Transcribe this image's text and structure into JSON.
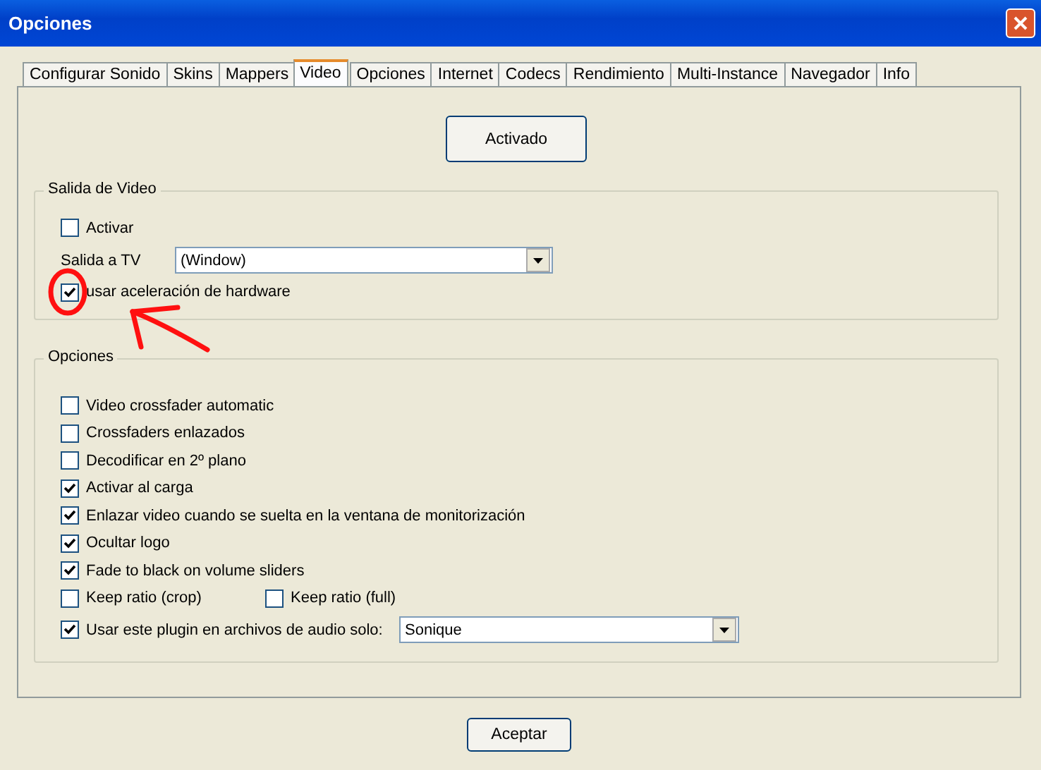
{
  "window": {
    "title": "Opciones"
  },
  "tabs": [
    {
      "label": "Configurar Sonido",
      "selected": false
    },
    {
      "label": "Skins",
      "selected": false
    },
    {
      "label": "Mappers",
      "selected": false
    },
    {
      "label": "Video",
      "selected": true
    },
    {
      "label": "Opciones",
      "selected": false
    },
    {
      "label": "Internet",
      "selected": false
    },
    {
      "label": "Codecs",
      "selected": false
    },
    {
      "label": "Rendimiento",
      "selected": false
    },
    {
      "label": "Multi-Instance",
      "selected": false
    },
    {
      "label": "Navegador",
      "selected": false
    },
    {
      "label": "Info",
      "selected": false
    }
  ],
  "top_button": "Activado",
  "video_output": {
    "title": "Salida de Video",
    "activate": {
      "label": "Activar",
      "checked": false
    },
    "tv_output": {
      "label": "Salida a TV",
      "value": "(Window)"
    },
    "hardware": {
      "label": "usar aceleración de hardware",
      "checked": true
    }
  },
  "options": {
    "title": "Opciones",
    "rows": [
      {
        "kind": "checkbox",
        "label": "Video crossfader automatic",
        "checked": false
      },
      {
        "kind": "checkbox",
        "label": "Crossfaders enlazados",
        "checked": false
      },
      {
        "kind": "checkbox",
        "label": "Decodificar en 2º plano",
        "checked": false
      },
      {
        "kind": "checkbox",
        "label": "Activar al carga",
        "checked": true
      },
      {
        "kind": "checkbox",
        "label": "Enlazar video cuando se suelta en la ventana de monitorización",
        "checked": true
      },
      {
        "kind": "checkbox",
        "label": "Ocultar logo",
        "checked": true
      },
      {
        "kind": "checkbox",
        "label": "Fade to black on volume sliders",
        "checked": true
      },
      {
        "kind": "pair",
        "items": [
          {
            "label": "Keep ratio (crop)",
            "checked": false
          },
          {
            "label": "Keep ratio (full)",
            "checked": false
          }
        ]
      },
      {
        "kind": "select",
        "label": "Usar este plugin en archivos de audio solo:",
        "checked": true,
        "value": "Sonique"
      }
    ]
  },
  "ok_button": "Aceptar"
}
